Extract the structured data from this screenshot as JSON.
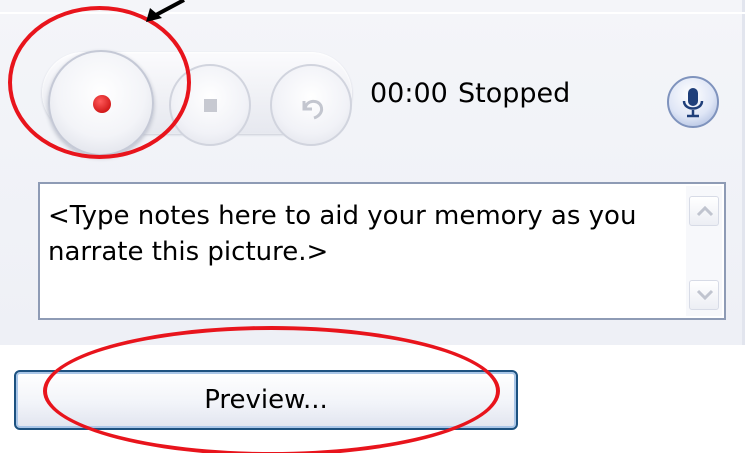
{
  "recorder": {
    "time": "00:00",
    "status": "Stopped",
    "record_button": "record",
    "stop_button": "stop",
    "undo_button": "undo",
    "mic_button": "microphone"
  },
  "notes": {
    "placeholder_text": "<Type notes here to aid your memory as you narrate this picture.>"
  },
  "preview": {
    "label": "Preview..."
  },
  "icons": {
    "record": "record-icon",
    "stop": "stop-icon",
    "undo": "undo-icon",
    "mic": "microphone-icon",
    "scroll_up": "chevron-up-icon",
    "scroll_down": "chevron-down-icon"
  },
  "colors": {
    "annotation": "#e8141c",
    "record_dot": "#c00000",
    "button_border": "#1c5180"
  }
}
